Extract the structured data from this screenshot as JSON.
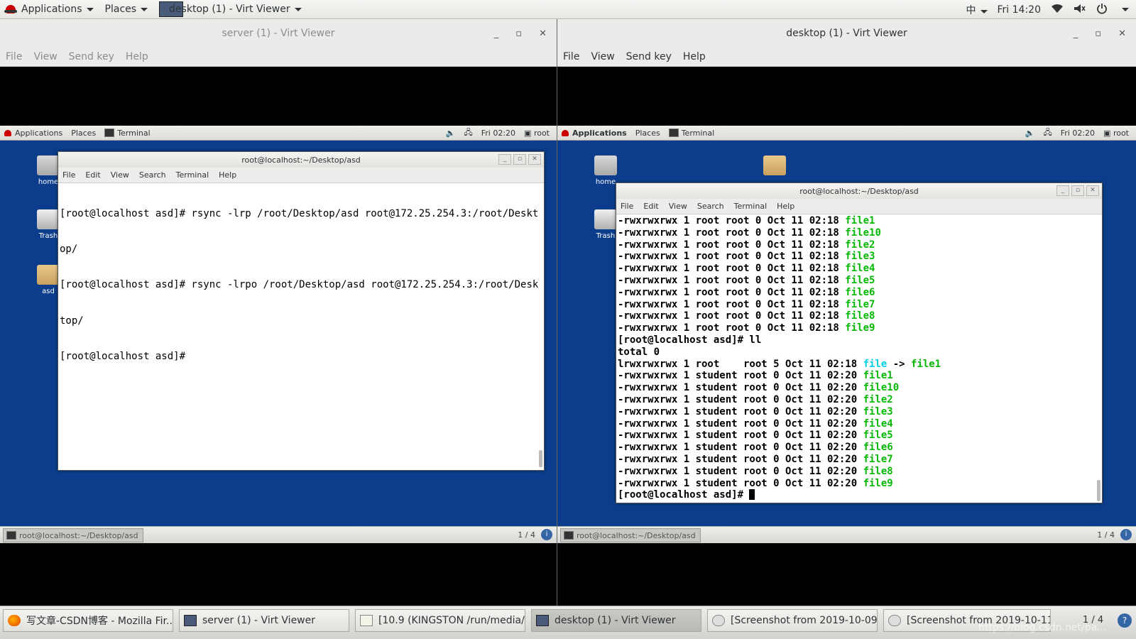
{
  "topbar": {
    "applications": "Applications",
    "places": "Places",
    "active_window": "desktop (1) - Virt Viewer",
    "input_method": "中",
    "clock": "Fri 14:20"
  },
  "left_window": {
    "title": "server (1) - Virt Viewer",
    "menu": [
      "File",
      "View",
      "Send key",
      "Help"
    ],
    "guest": {
      "applications": "Applications",
      "places": "Places",
      "terminal": "Terminal",
      "clock": "Fri 02:20",
      "user": "root",
      "icons": [
        "home",
        "Trash",
        "asd"
      ],
      "taskbar_item": "root@localhost:~/Desktop/asd",
      "page": "1 / 4",
      "terminal_window": {
        "title": "root@localhost:~/Desktop/asd",
        "menu": [
          "File",
          "Edit",
          "View",
          "Search",
          "Terminal",
          "Help"
        ],
        "lines": [
          "[root@localhost asd]# rsync -lrp /root/Desktop/asd root@172.25.254.3:/root/Deskt",
          "op/",
          "[root@localhost asd]# rsync -lrpo /root/Desktop/asd root@172.25.254.3:/root/Desk",
          "top/",
          "[root@localhost asd]#"
        ]
      }
    }
  },
  "right_window": {
    "title": "desktop (1) - Virt Viewer",
    "menu": [
      "File",
      "View",
      "Send key",
      "Help"
    ],
    "guest": {
      "applications": "Applications",
      "places": "Places",
      "terminal": "Terminal",
      "clock": "Fri 02:20",
      "user": "root",
      "icons": [
        "home",
        "Trash"
      ],
      "taskbar_item": "root@localhost:~/Desktop/asd",
      "page": "1 / 4",
      "terminal_window": {
        "title": "root@localhost:~/Desktop/asd",
        "menu": [
          "File",
          "Edit",
          "View",
          "Search",
          "Terminal",
          "Help"
        ],
        "lines": [
          {
            "prefix": "-rwxrwxrwx 1 root root 0 Oct 11 02:18 ",
            "name": "file1"
          },
          {
            "prefix": "-rwxrwxrwx 1 root root 0 Oct 11 02:18 ",
            "name": "file10"
          },
          {
            "prefix": "-rwxrwxrwx 1 root root 0 Oct 11 02:18 ",
            "name": "file2"
          },
          {
            "prefix": "-rwxrwxrwx 1 root root 0 Oct 11 02:18 ",
            "name": "file3"
          },
          {
            "prefix": "-rwxrwxrwx 1 root root 0 Oct 11 02:18 ",
            "name": "file4"
          },
          {
            "prefix": "-rwxrwxrwx 1 root root 0 Oct 11 02:18 ",
            "name": "file5"
          },
          {
            "prefix": "-rwxrwxrwx 1 root root 0 Oct 11 02:18 ",
            "name": "file6"
          },
          {
            "prefix": "-rwxrwxrwx 1 root root 0 Oct 11 02:18 ",
            "name": "file7"
          },
          {
            "prefix": "-rwxrwxrwx 1 root root 0 Oct 11 02:18 ",
            "name": "file8"
          },
          {
            "prefix": "-rwxrwxrwx 1 root root 0 Oct 11 02:18 ",
            "name": "file9"
          },
          {
            "prefix": "[root@localhost asd]# ll",
            "name": ""
          },
          {
            "prefix": "total 0",
            "name": ""
          },
          {
            "prefix": "lrwxrwxrwx 1 root    root 5 Oct 11 02:18 ",
            "name": "file",
            "arrow": " -> ",
            "target": "file1"
          },
          {
            "prefix": "-rwxrwxrwx 1 student root 0 Oct 11 02:20 ",
            "name": "file1"
          },
          {
            "prefix": "-rwxrwxrwx 1 student root 0 Oct 11 02:20 ",
            "name": "file10"
          },
          {
            "prefix": "-rwxrwxrwx 1 student root 0 Oct 11 02:20 ",
            "name": "file2"
          },
          {
            "prefix": "-rwxrwxrwx 1 student root 0 Oct 11 02:20 ",
            "name": "file3"
          },
          {
            "prefix": "-rwxrwxrwx 1 student root 0 Oct 11 02:20 ",
            "name": "file4"
          },
          {
            "prefix": "-rwxrwxrwx 1 student root 0 Oct 11 02:20 ",
            "name": "file5"
          },
          {
            "prefix": "-rwxrwxrwx 1 student root 0 Oct 11 02:20 ",
            "name": "file6"
          },
          {
            "prefix": "-rwxrwxrwx 1 student root 0 Oct 11 02:20 ",
            "name": "file7"
          },
          {
            "prefix": "-rwxrwxrwx 1 student root 0 Oct 11 02:20 ",
            "name": "file8"
          },
          {
            "prefix": "-rwxrwxrwx 1 student root 0 Oct 11 02:20 ",
            "name": "file9"
          }
        ],
        "prompt": "[root@localhost asd]# "
      }
    }
  },
  "taskbar": {
    "items": [
      "写文章-CSDN博客 - Mozilla Fir...",
      "server (1) - Virt Viewer",
      "[10.9 (KINGSTON /run/media/ki...",
      "desktop (1) - Virt Viewer",
      "[Screenshot from 2019-10-09...",
      "[Screenshot from 2019-10-11..."
    ],
    "page": "1 / 4",
    "watermark": "https://blog.csdn.net/pa..."
  },
  "colors": {
    "guest_desktop": "#0b3d8c",
    "filename_green": "#07b907",
    "symlink_cyan": "#00d0e8"
  }
}
